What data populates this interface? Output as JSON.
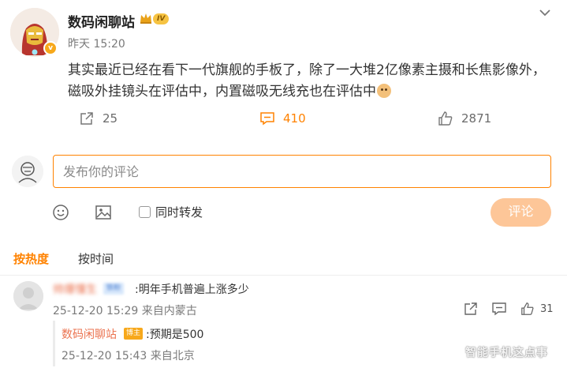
{
  "post": {
    "author": "数码闲聊站",
    "level_badge": "IV",
    "avatar_badge": "v",
    "time": "昨天 15:20",
    "content": "其实最近已经在看下一代旗舰的手板了，除了一大堆2亿像素主摄和长焦影像外，磁吸外挂镜头在评估中，内置磁吸无线充也在评估中",
    "emoji_icon": "doge-emoji-icon",
    "actions": {
      "share_count": "25",
      "comment_count": "410",
      "like_count": "2871"
    },
    "accent_color": "#ff8200"
  },
  "composer": {
    "placeholder": "发布你的评论",
    "also_repost_label": "同时转发",
    "submit_label": "评论"
  },
  "sort_tabs": {
    "by_hot": "按热度",
    "by_time": "按时间"
  },
  "comments": [
    {
      "name": "帅爆懂生",
      "badge": "铁粉",
      "text": ":明年手机普遍上涨多少",
      "meta": "25-12-20 15:29 来自内蒙古",
      "like_count": "31",
      "reply": {
        "name": "数码闲聊站",
        "badge": "博主",
        "text": ":预期是500",
        "meta": "25-12-20 15:43 来自北京"
      }
    }
  ],
  "watermark": "智能手机这点事"
}
